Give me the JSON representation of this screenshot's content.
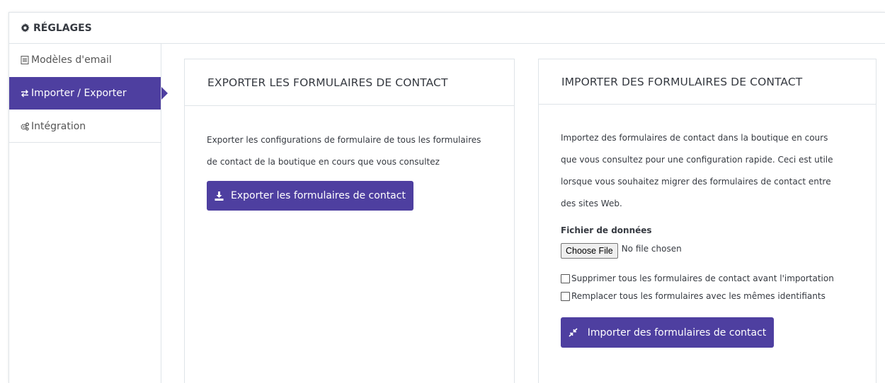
{
  "header": {
    "title": "RÉGLAGES",
    "icon": "gear-icon"
  },
  "sidebar": {
    "items": [
      {
        "label": "Modèles d'email",
        "icon": "document-icon",
        "active": false
      },
      {
        "label": "Importer / Exporter",
        "icon": "exchange-arrows-icon",
        "active": true
      },
      {
        "label": "Intégration",
        "icon": "cogs-icon",
        "active": false
      }
    ]
  },
  "export_panel": {
    "title": "EXPORTER LES FORMULAIRES DE CONTACT",
    "desc_line1": "Exporter les configurations de formulaire de tous les formulaires",
    "desc_line2": "de contact de la boutique en cours que vous consultez",
    "button_label": "Exporter les formulaires de contact",
    "button_icon": "download-icon"
  },
  "import_panel": {
    "title": "IMPORTER DES FORMULAIRES DE CONTACT",
    "desc_line1": "Importez des formulaires de contact dans la boutique en cours",
    "desc_line2": "que vous consultez pour une configuration rapide. Ceci est utile",
    "desc_line3": "lorsque vous souhaitez migrer des formulaires de contact entre",
    "desc_line4": "des sites Web.",
    "file_label": "Fichier de données",
    "choose_file_label": "Choose File",
    "no_file_text": "No file chosen",
    "checkbox1_label": "Supprimer tous les formulaires de contact avant l'importation",
    "checkbox1_checked": false,
    "checkbox2_label": "Remplacer tous les formulaires avec les mêmes identifiants",
    "checkbox2_checked": false,
    "button_label": "Importer des formulaires de contact",
    "button_icon": "compress-arrows-icon"
  },
  "colors": {
    "accent": "#4e3fa0",
    "border": "#dfe4e8",
    "text": "#363a41"
  }
}
